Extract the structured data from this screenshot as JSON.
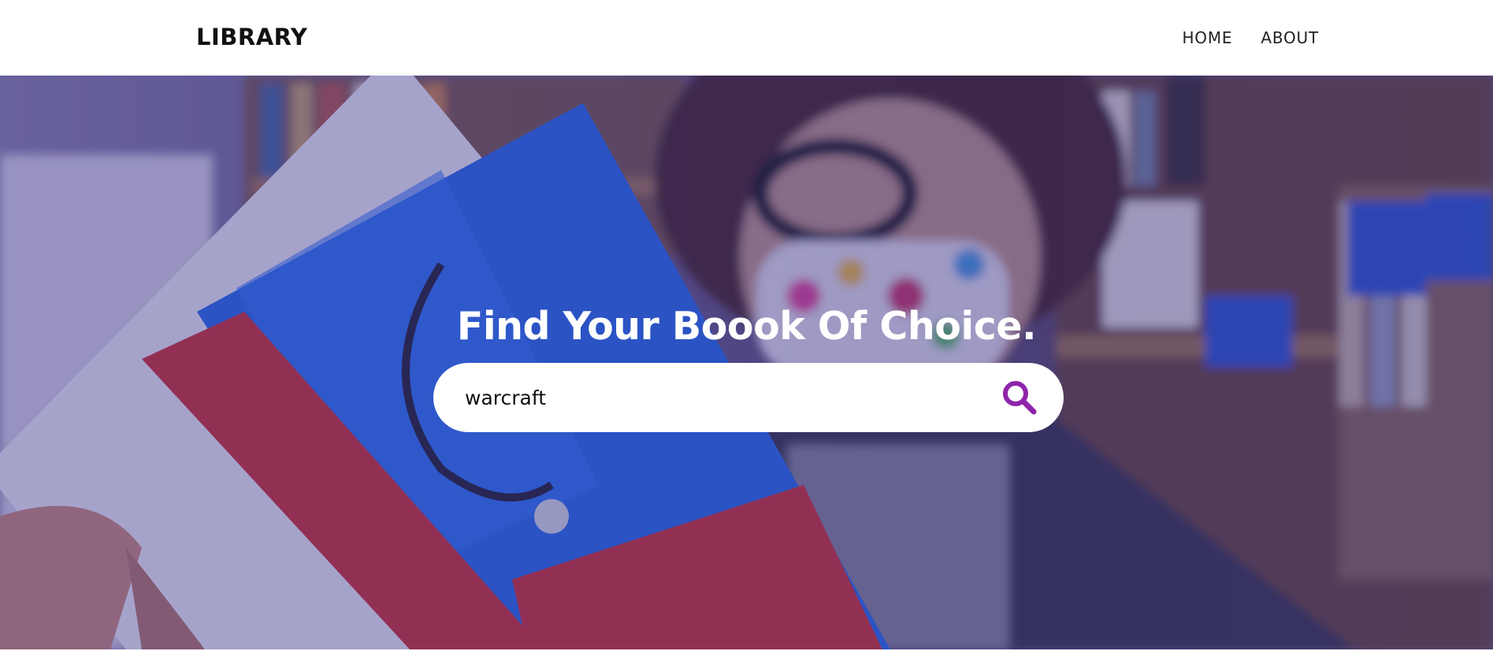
{
  "navbar": {
    "brand": "LIBRARY",
    "links": [
      {
        "label": "HOME"
      },
      {
        "label": "ABOUT"
      }
    ]
  },
  "hero": {
    "title": "Find Your Boook Of Choice.",
    "background_image": "person-reading-book-in-library-photo",
    "search": {
      "value": "warcraft",
      "icon": "search-icon",
      "icon_color": "#8e24aa"
    }
  },
  "colors": {
    "navbar_bg": "#ffffff",
    "overlay": "#231e8c",
    "accent": "#8e24aa"
  }
}
